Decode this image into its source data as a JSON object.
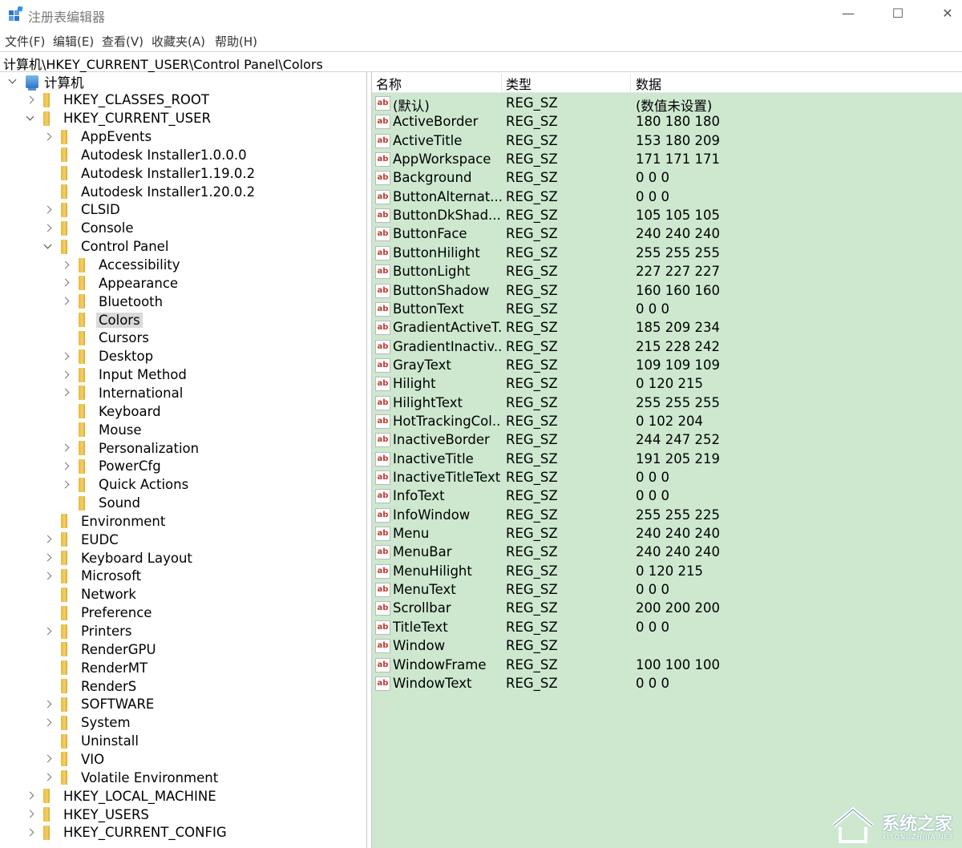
{
  "window": {
    "title": "注册表编辑器",
    "minimize": "—",
    "maximize": "☐",
    "close": "✕"
  },
  "menu": [
    "文件(F)",
    "编辑(E)",
    "查看(V)",
    "收藏夹(A)",
    "帮助(H)"
  ],
  "address": "计算机\\HKEY_CURRENT_USER\\Control Panel\\Colors",
  "tree": [
    {
      "label": "计算机",
      "level": 0,
      "expander": "down",
      "icon": "computer"
    },
    {
      "label": "HKEY_CLASSES_ROOT",
      "level": 1,
      "expander": "right",
      "icon": "folder"
    },
    {
      "label": "HKEY_CURRENT_USER",
      "level": 1,
      "expander": "down",
      "icon": "folder"
    },
    {
      "label": "AppEvents",
      "level": 2,
      "expander": "right",
      "icon": "folder"
    },
    {
      "label": "Autodesk Installer1.0.0.0",
      "level": 2,
      "expander": "none",
      "icon": "folder"
    },
    {
      "label": "Autodesk Installer1.19.0.2",
      "level": 2,
      "expander": "none",
      "icon": "folder"
    },
    {
      "label": "Autodesk Installer1.20.0.2",
      "level": 2,
      "expander": "none",
      "icon": "folder"
    },
    {
      "label": "CLSID",
      "level": 2,
      "expander": "right",
      "icon": "folder"
    },
    {
      "label": "Console",
      "level": 2,
      "expander": "right",
      "icon": "folder"
    },
    {
      "label": "Control Panel",
      "level": 2,
      "expander": "down",
      "icon": "folder"
    },
    {
      "label": "Accessibility",
      "level": 3,
      "expander": "right",
      "icon": "folder"
    },
    {
      "label": "Appearance",
      "level": 3,
      "expander": "right",
      "icon": "folder"
    },
    {
      "label": "Bluetooth",
      "level": 3,
      "expander": "right",
      "icon": "folder"
    },
    {
      "label": "Colors",
      "level": 3,
      "expander": "none",
      "icon": "folder",
      "selected": true
    },
    {
      "label": "Cursors",
      "level": 3,
      "expander": "none",
      "icon": "folder"
    },
    {
      "label": "Desktop",
      "level": 3,
      "expander": "right",
      "icon": "folder"
    },
    {
      "label": "Input Method",
      "level": 3,
      "expander": "right",
      "icon": "folder"
    },
    {
      "label": "International",
      "level": 3,
      "expander": "right",
      "icon": "folder"
    },
    {
      "label": "Keyboard",
      "level": 3,
      "expander": "none",
      "icon": "folder"
    },
    {
      "label": "Mouse",
      "level": 3,
      "expander": "none",
      "icon": "folder"
    },
    {
      "label": "Personalization",
      "level": 3,
      "expander": "right",
      "icon": "folder"
    },
    {
      "label": "PowerCfg",
      "level": 3,
      "expander": "right",
      "icon": "folder"
    },
    {
      "label": "Quick Actions",
      "level": 3,
      "expander": "right",
      "icon": "folder"
    },
    {
      "label": "Sound",
      "level": 3,
      "expander": "none",
      "icon": "folder"
    },
    {
      "label": "Environment",
      "level": 2,
      "expander": "none",
      "icon": "folder"
    },
    {
      "label": "EUDC",
      "level": 2,
      "expander": "right",
      "icon": "folder"
    },
    {
      "label": "Keyboard Layout",
      "level": 2,
      "expander": "right",
      "icon": "folder"
    },
    {
      "label": "Microsoft",
      "level": 2,
      "expander": "right",
      "icon": "folder"
    },
    {
      "label": "Network",
      "level": 2,
      "expander": "none",
      "icon": "folder"
    },
    {
      "label": "Preference",
      "level": 2,
      "expander": "none",
      "icon": "folder"
    },
    {
      "label": "Printers",
      "level": 2,
      "expander": "right",
      "icon": "folder"
    },
    {
      "label": "RenderGPU",
      "level": 2,
      "expander": "none",
      "icon": "folder"
    },
    {
      "label": "RenderMT",
      "level": 2,
      "expander": "none",
      "icon": "folder"
    },
    {
      "label": "RenderS",
      "level": 2,
      "expander": "none",
      "icon": "folder"
    },
    {
      "label": "SOFTWARE",
      "level": 2,
      "expander": "right",
      "icon": "folder"
    },
    {
      "label": "System",
      "level": 2,
      "expander": "right",
      "icon": "folder"
    },
    {
      "label": "Uninstall",
      "level": 2,
      "expander": "none",
      "icon": "folder"
    },
    {
      "label": "VIO",
      "level": 2,
      "expander": "right",
      "icon": "folder"
    },
    {
      "label": "Volatile Environment",
      "level": 2,
      "expander": "right",
      "icon": "folder"
    },
    {
      "label": "HKEY_LOCAL_MACHINE",
      "level": 1,
      "expander": "right",
      "icon": "folder"
    },
    {
      "label": "HKEY_USERS",
      "level": 1,
      "expander": "right",
      "icon": "folder"
    },
    {
      "label": "HKEY_CURRENT_CONFIG",
      "level": 1,
      "expander": "right",
      "icon": "folder"
    }
  ],
  "list": {
    "headers": {
      "name": "名称",
      "type": "类型",
      "data": "数据"
    },
    "icon_text": "ab",
    "rows": [
      {
        "name": "(默认)",
        "type": "REG_SZ",
        "data": "(数值未设置)"
      },
      {
        "name": "ActiveBorder",
        "type": "REG_SZ",
        "data": "180 180 180"
      },
      {
        "name": "ActiveTitle",
        "type": "REG_SZ",
        "data": "153 180 209"
      },
      {
        "name": "AppWorkspace",
        "type": "REG_SZ",
        "data": "171 171 171"
      },
      {
        "name": "Background",
        "type": "REG_SZ",
        "data": "0 0 0"
      },
      {
        "name": "ButtonAlternat...",
        "type": "REG_SZ",
        "data": "0 0 0"
      },
      {
        "name": "ButtonDkShad...",
        "type": "REG_SZ",
        "data": "105 105 105"
      },
      {
        "name": "ButtonFace",
        "type": "REG_SZ",
        "data": "240 240 240"
      },
      {
        "name": "ButtonHilight",
        "type": "REG_SZ",
        "data": "255 255 255"
      },
      {
        "name": "ButtonLight",
        "type": "REG_SZ",
        "data": "227 227 227"
      },
      {
        "name": "ButtonShadow",
        "type": "REG_SZ",
        "data": "160 160 160"
      },
      {
        "name": "ButtonText",
        "type": "REG_SZ",
        "data": "0 0 0"
      },
      {
        "name": "GradientActiveT...",
        "type": "REG_SZ",
        "data": "185 209 234"
      },
      {
        "name": "GradientInactiv...",
        "type": "REG_SZ",
        "data": "215 228 242"
      },
      {
        "name": "GrayText",
        "type": "REG_SZ",
        "data": "109 109 109"
      },
      {
        "name": "Hilight",
        "type": "REG_SZ",
        "data": "0 120 215"
      },
      {
        "name": "HilightText",
        "type": "REG_SZ",
        "data": "255 255 255"
      },
      {
        "name": "HotTrackingCol...",
        "type": "REG_SZ",
        "data": "0 102 204"
      },
      {
        "name": "InactiveBorder",
        "type": "REG_SZ",
        "data": "244 247 252"
      },
      {
        "name": "InactiveTitle",
        "type": "REG_SZ",
        "data": "191 205 219"
      },
      {
        "name": "InactiveTitleText",
        "type": "REG_SZ",
        "data": "0 0 0"
      },
      {
        "name": "InfoText",
        "type": "REG_SZ",
        "data": "0 0 0"
      },
      {
        "name": "InfoWindow",
        "type": "REG_SZ",
        "data": "255 255 225"
      },
      {
        "name": "Menu",
        "type": "REG_SZ",
        "data": "240 240 240"
      },
      {
        "name": "MenuBar",
        "type": "REG_SZ",
        "data": "240 240 240"
      },
      {
        "name": "MenuHilight",
        "type": "REG_SZ",
        "data": "0 120 215"
      },
      {
        "name": "MenuText",
        "type": "REG_SZ",
        "data": "0 0 0"
      },
      {
        "name": "Scrollbar",
        "type": "REG_SZ",
        "data": "200 200 200"
      },
      {
        "name": "TitleText",
        "type": "REG_SZ",
        "data": "0 0 0"
      },
      {
        "name": "Window",
        "type": "REG_SZ",
        "data": ""
      },
      {
        "name": "WindowFrame",
        "type": "REG_SZ",
        "data": "100 100 100"
      },
      {
        "name": "WindowText",
        "type": "REG_SZ",
        "data": "0 0 0"
      }
    ]
  },
  "colors": {
    "list_background": "#cde8cf",
    "selected_tree_item": "#d9d9d9",
    "folder": "#f3cf6a"
  },
  "watermark": {
    "text": "系统之家",
    "sub": "XITONGZHIJIA.NET"
  }
}
